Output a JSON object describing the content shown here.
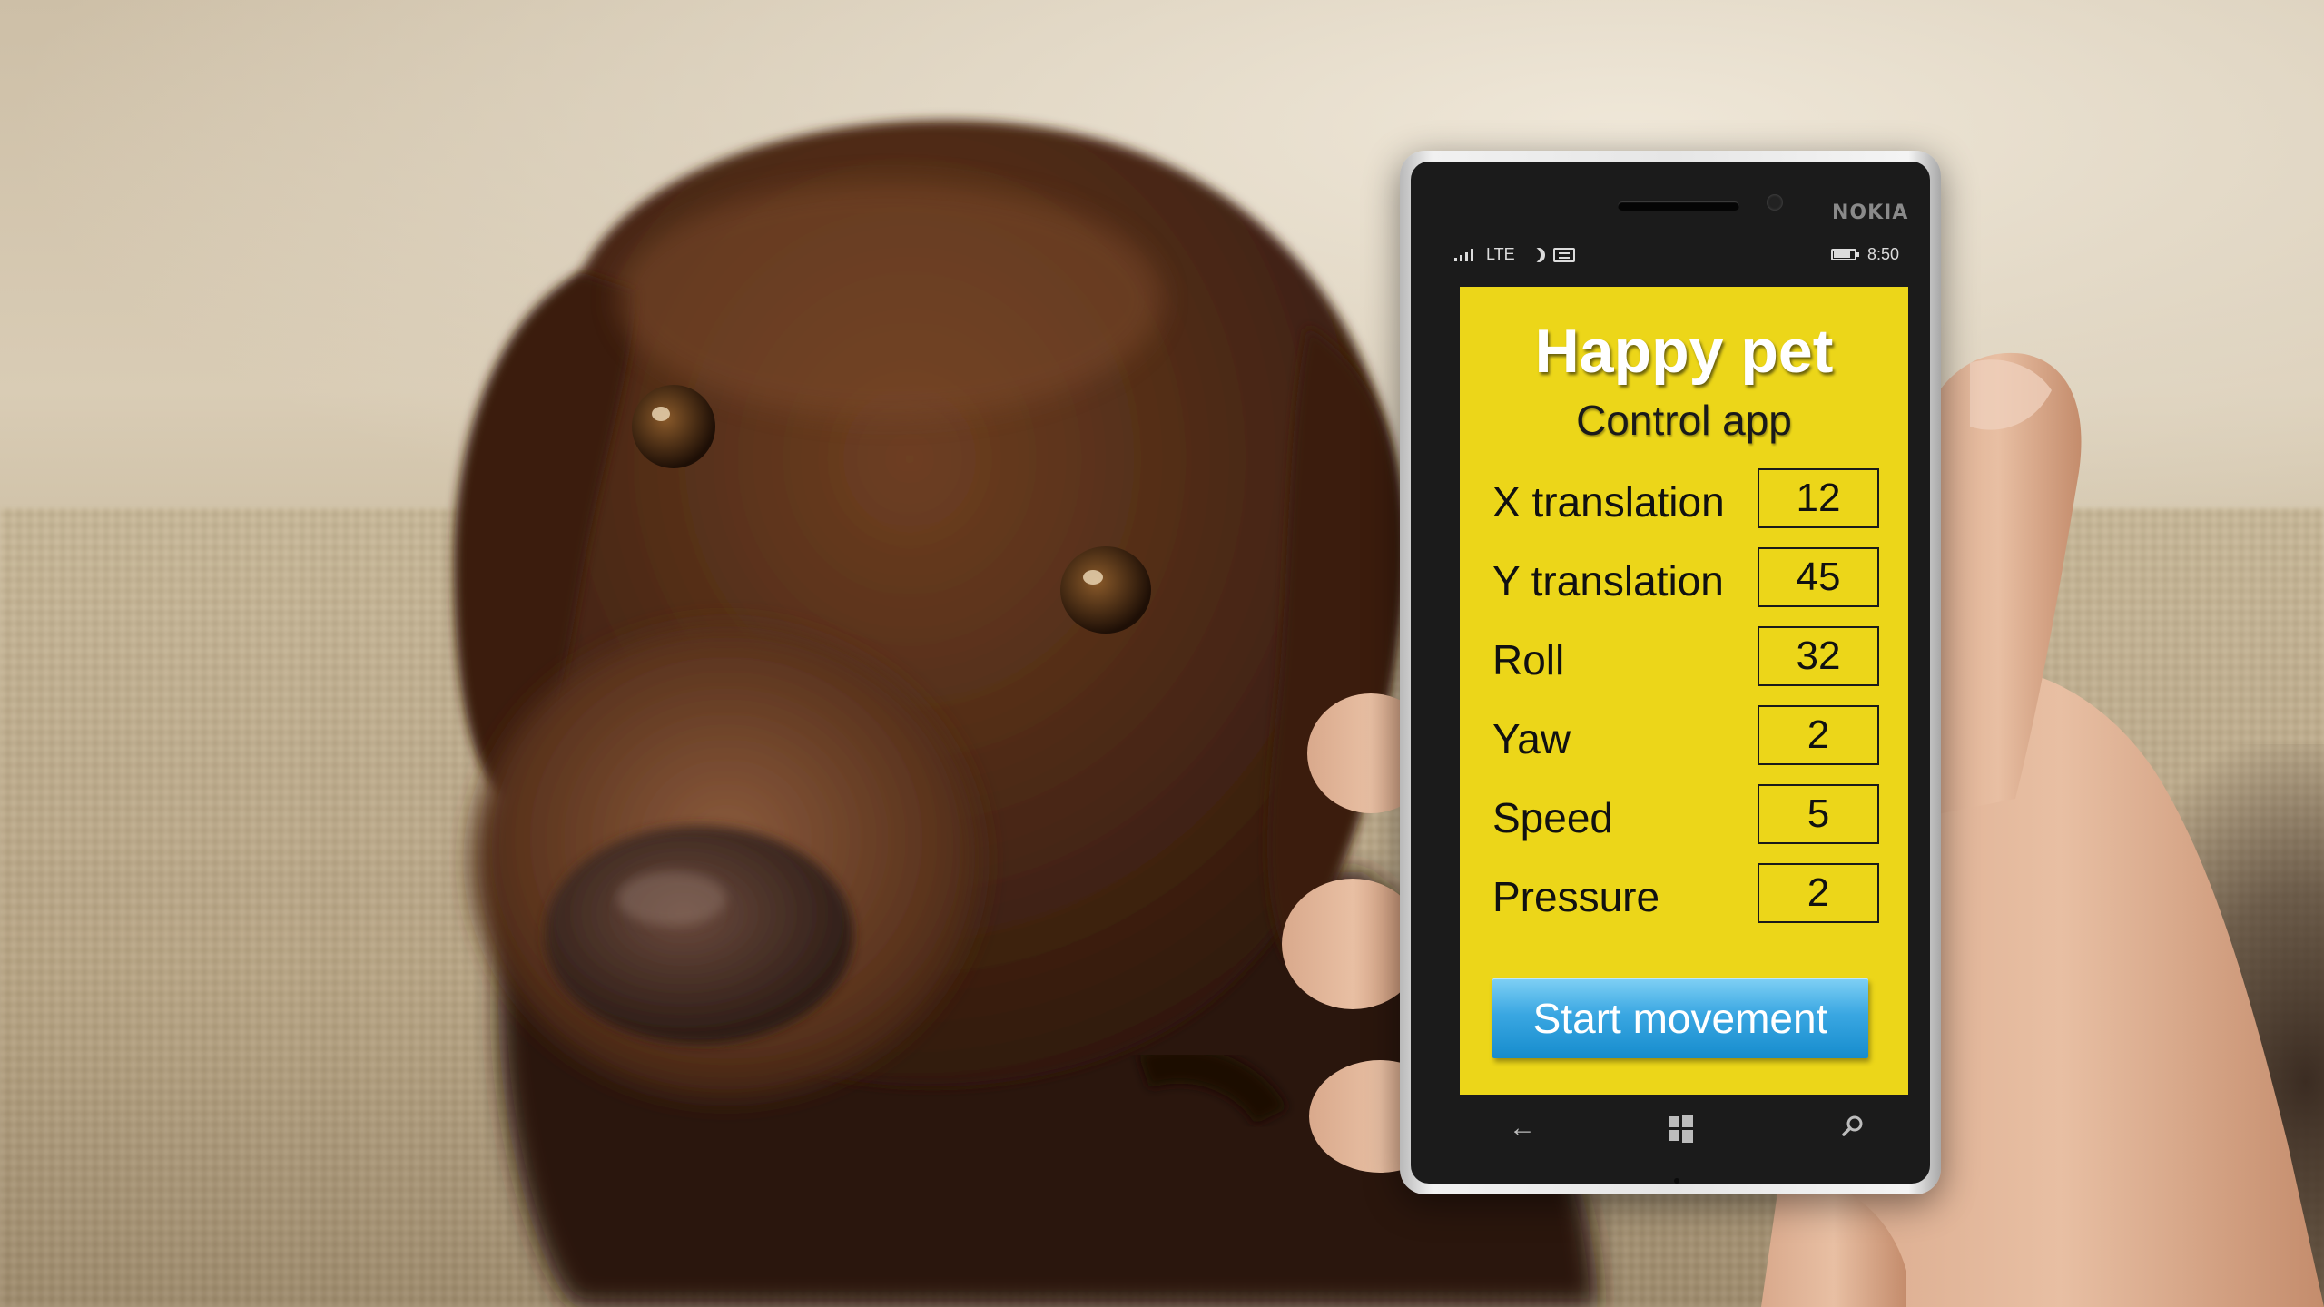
{
  "phone": {
    "brand": "NOKIA",
    "status": {
      "network": "LTE",
      "time": "8:50",
      "icons": [
        "signal-icon",
        "moon-icon",
        "message-icon",
        "battery-icon"
      ]
    },
    "nav_icons": [
      "back-arrow-icon",
      "windows-icon",
      "search-icon"
    ]
  },
  "app": {
    "title": "Happy pet",
    "subtitle": "Control app",
    "background_color": "#ECD619",
    "params": [
      {
        "label": "X translation",
        "value": "12"
      },
      {
        "label": "Y translation",
        "value": "45"
      },
      {
        "label": "Roll",
        "value": "32"
      },
      {
        "label": "Yaw",
        "value": "2"
      },
      {
        "label": "Speed",
        "value": "5"
      },
      {
        "label": "Pressure",
        "value": "2"
      }
    ],
    "start_button": "Start movement",
    "button_color": "#2B9FDD"
  }
}
